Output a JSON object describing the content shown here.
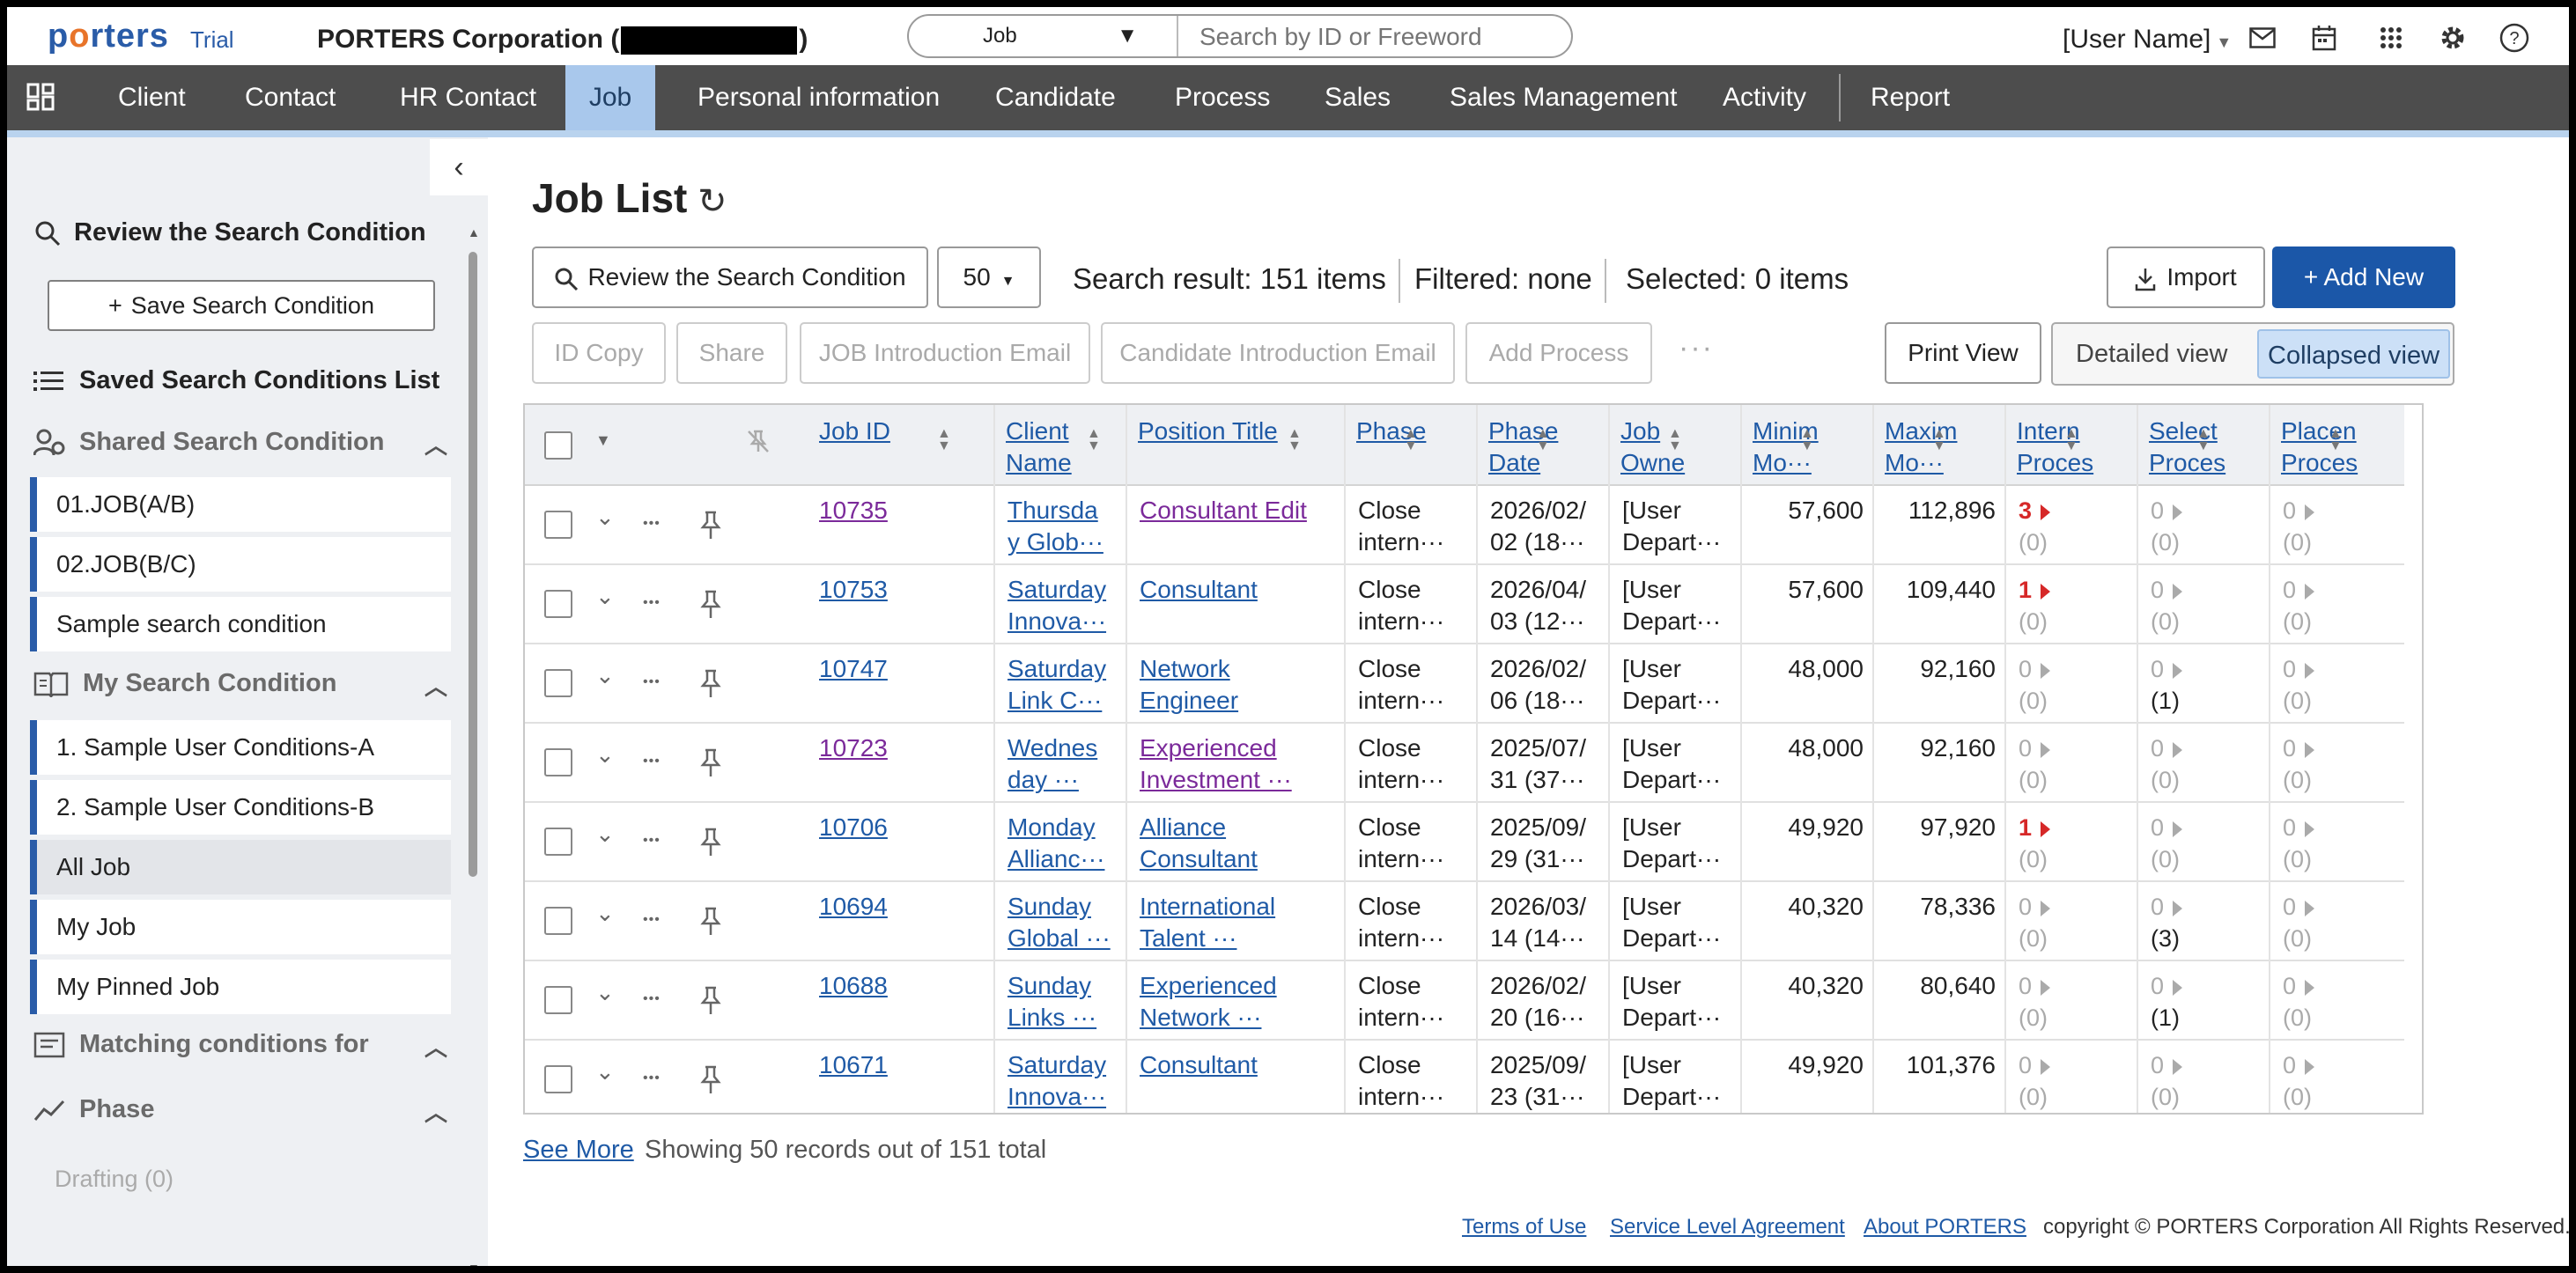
{
  "header": {
    "logo": "porters",
    "trial": "Trial",
    "company": "PORTERS Corporation (",
    "company_close": ")",
    "search_type": "Job",
    "search_placeholder": "Search by ID or Freeword",
    "user_name": "[User Name]"
  },
  "nav": {
    "items": [
      "Client",
      "Contact",
      "HR Contact",
      "Job",
      "Personal information",
      "Candidate",
      "Process",
      "Sales",
      "Sales Management",
      "Activity",
      "Report"
    ],
    "active": "Job"
  },
  "sidebar": {
    "review": "Review the Search Condition",
    "save": "Save Search Condition",
    "saved_list": "Saved Search Conditions List",
    "shared_heading": "Shared Search Condition",
    "shared_items": [
      "01.JOB(A/B)",
      "02.JOB(B/C)",
      "Sample search condition"
    ],
    "my_heading": "My Search Condition",
    "my_items": [
      "1. Sample User Conditions-A",
      "2. Sample User Conditions-B",
      "All Job",
      "My Job",
      "My Pinned Job"
    ],
    "selected": "All Job",
    "matching_heading": "Matching conditions for",
    "phase_heading": "Phase",
    "drafting": "Drafting (0)"
  },
  "main": {
    "title": "Job List",
    "review_btn": "Review the Search Condition",
    "page_size": "50",
    "search_result": "Search result: 151 items",
    "filtered": "Filtered: none",
    "selected": "Selected:  0 items",
    "import_btn": "Import",
    "add_btn": "+ Add New",
    "actions": [
      "ID Copy",
      "Share",
      "JOB Introduction Email",
      "Candidate Introduction Email",
      "Add Process"
    ],
    "more": "···",
    "print_btn": "Print View",
    "view_detailed": "Detailed view",
    "view_collapsed": "Collapsed view",
    "see_more": "See More",
    "showing": "Showing 50 records out of 151 total"
  },
  "table": {
    "columns": [
      {
        "l1": "Job ID",
        "l2": ""
      },
      {
        "l1": "Client",
        "l2": "Name"
      },
      {
        "l1": "Position Title",
        "l2": ""
      },
      {
        "l1": "Phase",
        "l2": ""
      },
      {
        "l1": "Phase",
        "l2": "Date"
      },
      {
        "l1": "Job",
        "l2": "Owne"
      },
      {
        "l1": "Minim",
        "l2": "Mo···"
      },
      {
        "l1": "Maxim",
        "l2": "Mo···"
      },
      {
        "l1": "Intern",
        "l2": "Proces"
      },
      {
        "l1": "Select",
        "l2": "Proces"
      },
      {
        "l1": "Placen",
        "l2": "Proces"
      }
    ],
    "rows": [
      {
        "id": "10735",
        "client1": "Thursda",
        "client2": "y Glob···",
        "pos1": "Consultant Edit",
        "pos2": "",
        "phase1": "Close",
        "phase2": "intern···",
        "date1": "2026/02/",
        "date2": "02 (18···",
        "owner1": "[User",
        "owner2": "Depart···",
        "min": "57,600",
        "max": "112,896",
        "int": "3",
        "int_sub": "(0)",
        "sel": "0",
        "sel_sub": "(0)",
        "plc": "0",
        "plc_sub": "(0)"
      },
      {
        "id": "10753",
        "client1": "Saturday",
        "client2": "Innova···",
        "pos1": "Consultant",
        "pos2": "",
        "phase1": "Close",
        "phase2": "intern···",
        "date1": "2026/04/",
        "date2": "03 (12···",
        "owner1": "[User",
        "owner2": "Depart···",
        "min": "57,600",
        "max": "109,440",
        "int": "1",
        "int_sub": "(0)",
        "sel": "0",
        "sel_sub": "(0)",
        "plc": "0",
        "plc_sub": "(0)"
      },
      {
        "id": "10747",
        "client1": "Saturday",
        "client2": "Link C···",
        "pos1": "Network",
        "pos2": "Engineer",
        "phase1": "Close",
        "phase2": "intern···",
        "date1": "2026/02/",
        "date2": "06 (18···",
        "owner1": "[User",
        "owner2": "Depart···",
        "min": "48,000",
        "max": "92,160",
        "int": "0",
        "int_sub": "(0)",
        "sel": "0",
        "sel_sub": "(1)",
        "plc": "0",
        "plc_sub": "(0)"
      },
      {
        "id": "10723",
        "client1": "Wednes",
        "client2": "day ···",
        "pos1": "Experienced",
        "pos2": "Investment ···",
        "phase1": "Close",
        "phase2": "intern···",
        "date1": "2025/07/",
        "date2": "31 (37···",
        "owner1": "[User",
        "owner2": "Depart···",
        "min": "48,000",
        "max": "92,160",
        "int": "0",
        "int_sub": "(0)",
        "sel": "0",
        "sel_sub": "(0)",
        "plc": "0",
        "plc_sub": "(0)"
      },
      {
        "id": "10706",
        "client1": "Monday",
        "client2": "Allianc···",
        "pos1": "Alliance",
        "pos2": "Consultant",
        "phase1": "Close",
        "phase2": "intern···",
        "date1": "2025/09/",
        "date2": "29 (31···",
        "owner1": "[User",
        "owner2": "Depart···",
        "min": "49,920",
        "max": "97,920",
        "int": "1",
        "int_sub": "(0)",
        "sel": "0",
        "sel_sub": "(0)",
        "plc": "0",
        "plc_sub": "(0)"
      },
      {
        "id": "10694",
        "client1": "Sunday",
        "client2": "Global ···",
        "pos1": "International",
        "pos2": "Talent ···",
        "phase1": "Close",
        "phase2": "intern···",
        "date1": "2026/03/",
        "date2": "14 (14···",
        "owner1": "[User",
        "owner2": "Depart···",
        "min": "40,320",
        "max": "78,336",
        "int": "0",
        "int_sub": "(0)",
        "sel": "0",
        "sel_sub": "(3)",
        "plc": "0",
        "plc_sub": "(0)"
      },
      {
        "id": "10688",
        "client1": "Sunday",
        "client2": "Links ···",
        "pos1": "Experienced",
        "pos2": "Network ···",
        "phase1": "Close",
        "phase2": "intern···",
        "date1": "2026/02/",
        "date2": "20 (16···",
        "owner1": "[User",
        "owner2": "Depart···",
        "min": "40,320",
        "max": "80,640",
        "int": "0",
        "int_sub": "(0)",
        "sel": "0",
        "sel_sub": "(1)",
        "plc": "0",
        "plc_sub": "(0)"
      },
      {
        "id": "10671",
        "client1": "Saturday",
        "client2": "Innova···",
        "pos1": "Consultant",
        "pos2": "",
        "phase1": "Close",
        "phase2": "intern···",
        "date1": "2025/09/",
        "date2": "23 (31···",
        "owner1": "[User",
        "owner2": "Depart···",
        "min": "49,920",
        "max": "101,376",
        "int": "0",
        "int_sub": "(0)",
        "sel": "0",
        "sel_sub": "(0)",
        "plc": "0",
        "plc_sub": "(0)"
      }
    ],
    "visited_ids": [
      "10735",
      "10723"
    ],
    "visited_positions": [
      "10735",
      "10723"
    ]
  },
  "footer": {
    "links": [
      "Terms of Use",
      "Service Level Agreement",
      "About PORTERS"
    ],
    "copyright": "copyright © PORTERS Corporation All Rights Reserved."
  }
}
